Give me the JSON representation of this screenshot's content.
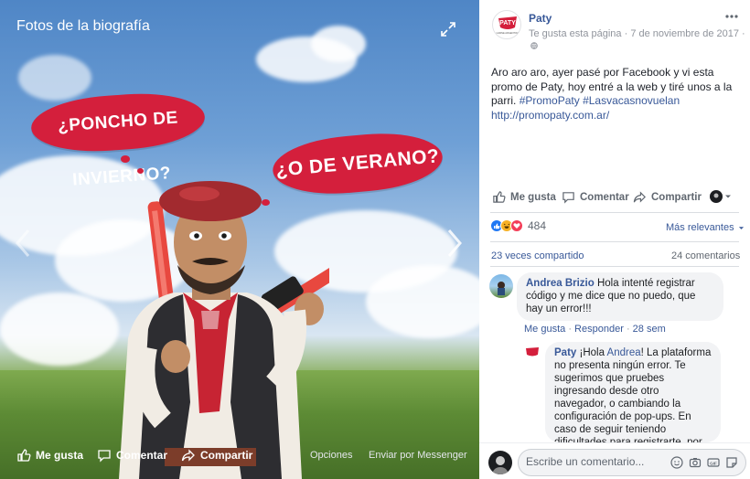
{
  "photo": {
    "title": "Fotos de la biografía",
    "bubble_1": "¿PONCHO DE INVIERNO?",
    "bubble_2": "¿O DE VERANO?",
    "actions": {
      "like": "Me gusta",
      "comment": "Comentar",
      "share": "Compartir",
      "options": "Opciones",
      "messenger": "Enviar por Messenger"
    }
  },
  "post": {
    "page_name": "Paty",
    "logo_text": "PATY",
    "logo_sub": "CARNE ARGENTINA",
    "liked_status": "Te gusta esta página",
    "separator": "·",
    "date": "7 de noviembre de 2017",
    "separator_2": "·",
    "text_plain": "Aro aro aro, ayer pasé por Facebook y vi esta promo de Paty, hoy entré a la web y tiré unos a la parri.",
    "hashtag_1": "#PromoPaty",
    "hashtag_2": "#Lasvacasnovuelan",
    "link": "http://promopaty.com.ar/"
  },
  "actions": {
    "like": "Me gusta",
    "comment": "Comentar",
    "share": "Compartir"
  },
  "reactions": {
    "count": "484",
    "sort_label": "Más relevantes",
    "shared": "23 veces compartido",
    "comments": "24 comentarios"
  },
  "comments": [
    {
      "author": "Andrea Brizio",
      "text": "Hola intenté registrar código y me dice que no puedo, que hay un error!!!",
      "like": "Me gusta",
      "reply": "Responder",
      "time": "28 sem",
      "dot_1": "·",
      "dot_2": "·"
    },
    {
      "author": "Paty",
      "text_lead": "¡Hola",
      "mention": "Andrea",
      "text": "! La plataforma no presenta ningún error. Te sugerimos que pruebes ingresando desde otro navegador, o cambiando la configuración de pop-ups. En caso de seguir teniendo dificultades para registrarte, por favor escribirnos"
    }
  ],
  "compose": {
    "placeholder": "Escribe un comentario...",
    "gif_label": "GIF"
  },
  "colors": {
    "link": "#385898",
    "bubble_red": "#d41f3c",
    "like_blue": "#2078f4",
    "love_red": "#f33e58",
    "haha_yellow": "#f7b125"
  }
}
